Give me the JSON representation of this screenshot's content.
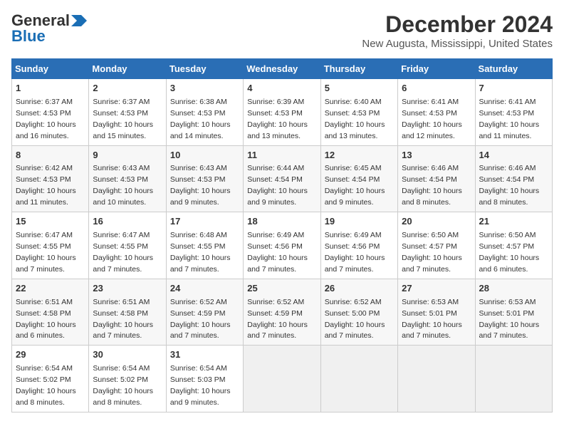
{
  "logo": {
    "line1": "General",
    "line2": "Blue",
    "arrow_unicode": "▶"
  },
  "title": "December 2024",
  "subtitle": "New Augusta, Mississippi, United States",
  "days_of_week": [
    "Sunday",
    "Monday",
    "Tuesday",
    "Wednesday",
    "Thursday",
    "Friday",
    "Saturday"
  ],
  "weeks": [
    [
      {
        "day": 1,
        "info": "Sunrise: 6:37 AM\nSunset: 4:53 PM\nDaylight: 10 hours\nand 16 minutes."
      },
      {
        "day": 2,
        "info": "Sunrise: 6:37 AM\nSunset: 4:53 PM\nDaylight: 10 hours\nand 15 minutes."
      },
      {
        "day": 3,
        "info": "Sunrise: 6:38 AM\nSunset: 4:53 PM\nDaylight: 10 hours\nand 14 minutes."
      },
      {
        "day": 4,
        "info": "Sunrise: 6:39 AM\nSunset: 4:53 PM\nDaylight: 10 hours\nand 13 minutes."
      },
      {
        "day": 5,
        "info": "Sunrise: 6:40 AM\nSunset: 4:53 PM\nDaylight: 10 hours\nand 13 minutes."
      },
      {
        "day": 6,
        "info": "Sunrise: 6:41 AM\nSunset: 4:53 PM\nDaylight: 10 hours\nand 12 minutes."
      },
      {
        "day": 7,
        "info": "Sunrise: 6:41 AM\nSunset: 4:53 PM\nDaylight: 10 hours\nand 11 minutes."
      }
    ],
    [
      {
        "day": 8,
        "info": "Sunrise: 6:42 AM\nSunset: 4:53 PM\nDaylight: 10 hours\nand 11 minutes."
      },
      {
        "day": 9,
        "info": "Sunrise: 6:43 AM\nSunset: 4:53 PM\nDaylight: 10 hours\nand 10 minutes."
      },
      {
        "day": 10,
        "info": "Sunrise: 6:43 AM\nSunset: 4:53 PM\nDaylight: 10 hours\nand 9 minutes."
      },
      {
        "day": 11,
        "info": "Sunrise: 6:44 AM\nSunset: 4:54 PM\nDaylight: 10 hours\nand 9 minutes."
      },
      {
        "day": 12,
        "info": "Sunrise: 6:45 AM\nSunset: 4:54 PM\nDaylight: 10 hours\nand 9 minutes."
      },
      {
        "day": 13,
        "info": "Sunrise: 6:46 AM\nSunset: 4:54 PM\nDaylight: 10 hours\nand 8 minutes."
      },
      {
        "day": 14,
        "info": "Sunrise: 6:46 AM\nSunset: 4:54 PM\nDaylight: 10 hours\nand 8 minutes."
      }
    ],
    [
      {
        "day": 15,
        "info": "Sunrise: 6:47 AM\nSunset: 4:55 PM\nDaylight: 10 hours\nand 7 minutes."
      },
      {
        "day": 16,
        "info": "Sunrise: 6:47 AM\nSunset: 4:55 PM\nDaylight: 10 hours\nand 7 minutes."
      },
      {
        "day": 17,
        "info": "Sunrise: 6:48 AM\nSunset: 4:55 PM\nDaylight: 10 hours\nand 7 minutes."
      },
      {
        "day": 18,
        "info": "Sunrise: 6:49 AM\nSunset: 4:56 PM\nDaylight: 10 hours\nand 7 minutes."
      },
      {
        "day": 19,
        "info": "Sunrise: 6:49 AM\nSunset: 4:56 PM\nDaylight: 10 hours\nand 7 minutes."
      },
      {
        "day": 20,
        "info": "Sunrise: 6:50 AM\nSunset: 4:57 PM\nDaylight: 10 hours\nand 7 minutes."
      },
      {
        "day": 21,
        "info": "Sunrise: 6:50 AM\nSunset: 4:57 PM\nDaylight: 10 hours\nand 6 minutes."
      }
    ],
    [
      {
        "day": 22,
        "info": "Sunrise: 6:51 AM\nSunset: 4:58 PM\nDaylight: 10 hours\nand 6 minutes."
      },
      {
        "day": 23,
        "info": "Sunrise: 6:51 AM\nSunset: 4:58 PM\nDaylight: 10 hours\nand 7 minutes."
      },
      {
        "day": 24,
        "info": "Sunrise: 6:52 AM\nSunset: 4:59 PM\nDaylight: 10 hours\nand 7 minutes."
      },
      {
        "day": 25,
        "info": "Sunrise: 6:52 AM\nSunset: 4:59 PM\nDaylight: 10 hours\nand 7 minutes."
      },
      {
        "day": 26,
        "info": "Sunrise: 6:52 AM\nSunset: 5:00 PM\nDaylight: 10 hours\nand 7 minutes."
      },
      {
        "day": 27,
        "info": "Sunrise: 6:53 AM\nSunset: 5:01 PM\nDaylight: 10 hours\nand 7 minutes."
      },
      {
        "day": 28,
        "info": "Sunrise: 6:53 AM\nSunset: 5:01 PM\nDaylight: 10 hours\nand 7 minutes."
      }
    ],
    [
      {
        "day": 29,
        "info": "Sunrise: 6:54 AM\nSunset: 5:02 PM\nDaylight: 10 hours\nand 8 minutes."
      },
      {
        "day": 30,
        "info": "Sunrise: 6:54 AM\nSunset: 5:02 PM\nDaylight: 10 hours\nand 8 minutes."
      },
      {
        "day": 31,
        "info": "Sunrise: 6:54 AM\nSunset: 5:03 PM\nDaylight: 10 hours\nand 9 minutes."
      },
      null,
      null,
      null,
      null
    ]
  ]
}
